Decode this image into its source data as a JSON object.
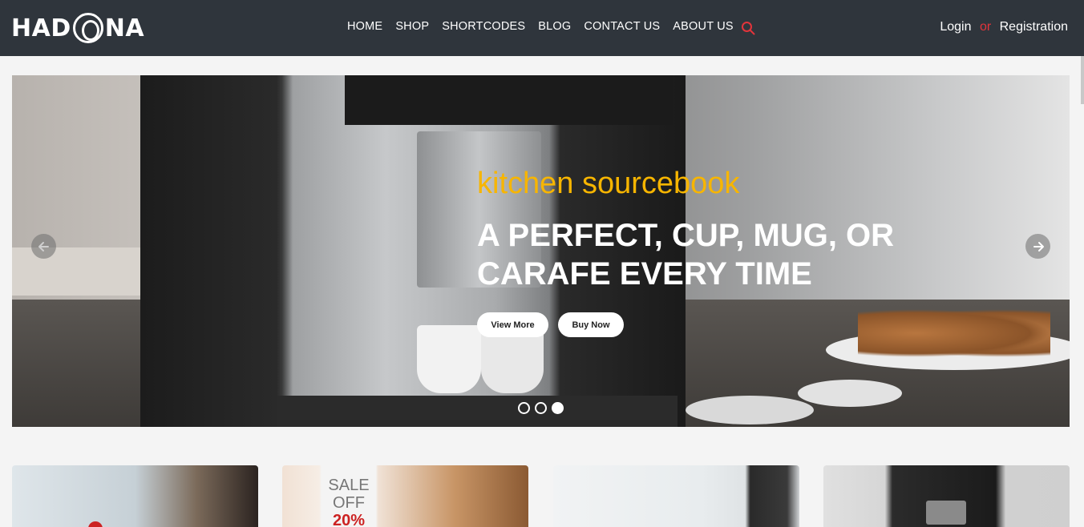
{
  "header": {
    "logo_text_left": "HAD",
    "logo_text_right": "NA",
    "nav": [
      "HOME",
      "SHOP",
      "SHORTCODES",
      "BLOG",
      "CONTACT US",
      "ABOUT US"
    ],
    "login": "Login",
    "or": "or",
    "registration": "Registration",
    "search_icon": "search-icon",
    "accent_color": "#e2343b"
  },
  "hero": {
    "subtitle": "kitchen sourcebook",
    "headline": "A PERFECT, CUP, MUG, OR CARAFE EVERY TIME",
    "view_more": "View More",
    "buy_now": "Buy Now",
    "subtitle_color": "#f7b500",
    "slide_count": 3,
    "active_slide": 3,
    "prev_icon": "arrow-left-icon",
    "next_icon": "arrow-right-icon"
  },
  "cards": {
    "card2": {
      "sale_line1": "SALE",
      "sale_line2": "OFF",
      "percent": "20%"
    }
  }
}
